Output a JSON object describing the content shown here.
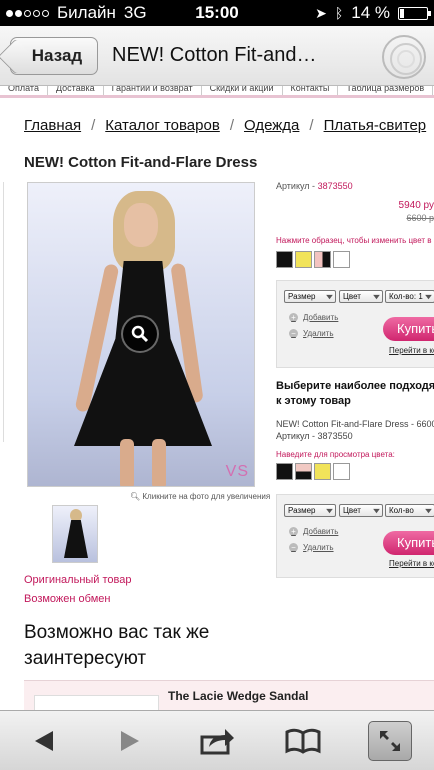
{
  "status_bar": {
    "carrier": "Билайн",
    "network": "3G",
    "time": "15:00",
    "battery": "14 %"
  },
  "nav": {
    "back_label": "Назад",
    "title": "NEW! Cotton Fit-and…"
  },
  "site_menu": [
    "Оплата",
    "Доставка",
    "Гарантии и возврат",
    "Скидки и акции",
    "Контакты",
    "Таблица размеров"
  ],
  "breadcrumbs": [
    "Главная",
    "Каталог товаров",
    "Одежда",
    "Платья-свитер"
  ],
  "breadcrumb_sep": "/",
  "product": {
    "title": "NEW! Cotton Fit-and-Flare Dress",
    "brand_mark": "VS",
    "zoom_hint": "Кликните на фото для увеличения",
    "badge_original": "Оригинальный товар",
    "badge_exchange": "Возможен обмен",
    "article_label": "Артикул - ",
    "article": "3873550",
    "price": "5940 ру",
    "old_price": "6600 р",
    "color_hint": "Нажмите образец, чтобы изменить цвет в фото",
    "colors": [
      "#111111",
      "#f1e35a",
      "#f3c3c0",
      "#ffffff"
    ]
  },
  "form1": {
    "size_label": "Размер",
    "color_label": "Цвет",
    "qty_label": "Кол-во: 1",
    "add_label": "Добавить",
    "remove_label": "Удалить",
    "buy_label": "Купить",
    "go_cart_label": "Перейти в корз"
  },
  "bundle": {
    "heading_line1": "Выберите наиболее подходя",
    "heading_line2": "к этому товар",
    "item_line1": "NEW! Cotton Fit-and-Flare Dress - 6600",
    "item_line2": "Артикул - 3873550",
    "hover_hint": "Наведите для просмотра цвета:",
    "colors": [
      "#111111",
      "#f1c9c3",
      "#f1e35a",
      "#ffffff"
    ]
  },
  "form2": {
    "size_label": "Размер",
    "color_label": "Цвет",
    "qty_label": "Кол-во",
    "add_label": "Добавить",
    "remove_label": "Удалить",
    "buy_label": "Купить",
    "go_cart_label": "Перейти в корз"
  },
  "recommend": {
    "heading": "Возможно вас так же заинтересуют",
    "item_title": "The Lacie Wedge Sandal"
  },
  "toolbar": {
    "icons": [
      "back-arrow-icon",
      "forward-arrow-icon",
      "share-icon",
      "bookmarks-icon",
      "fullscreen-icon"
    ]
  }
}
